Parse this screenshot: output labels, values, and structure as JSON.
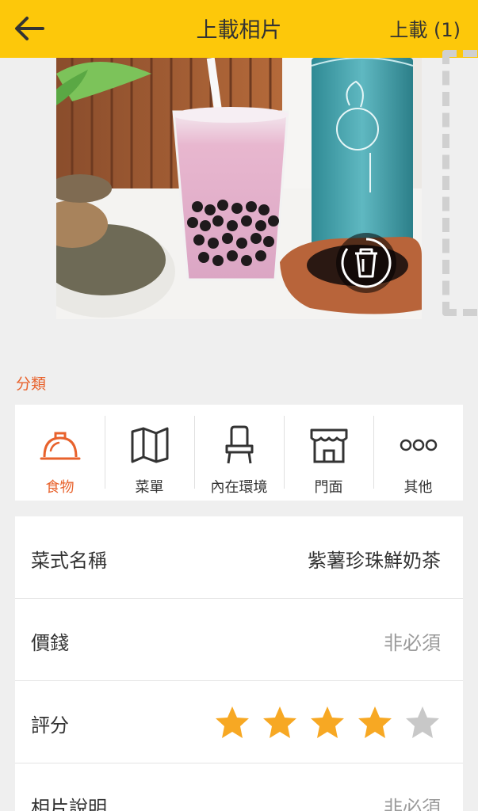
{
  "header": {
    "title": "上載相片",
    "upload_label": "上載 (1)"
  },
  "category": {
    "heading": "分類",
    "items": [
      {
        "label": "食物",
        "icon": "cloche-icon",
        "active": true
      },
      {
        "label": "菜單",
        "icon": "map-icon",
        "active": false
      },
      {
        "label": "內在環境",
        "icon": "chair-icon",
        "active": false
      },
      {
        "label": "門面",
        "icon": "storefront-icon",
        "active": false
      },
      {
        "label": "其他",
        "icon": "more-icon",
        "active": false
      }
    ]
  },
  "form": {
    "dish_name_label": "菜式名稱",
    "dish_name_value": "紫薯珍珠鮮奶茶",
    "price_label": "價錢",
    "price_placeholder": "非必須",
    "rating_label": "評分",
    "rating": 4,
    "rating_max": 5,
    "caption_label": "相片說明",
    "caption_placeholder": "非必須"
  },
  "colors": {
    "header_bg": "#fdc80a",
    "accent": "#e8622c",
    "star_on": "#f7a823",
    "star_off": "#c8c8c8"
  }
}
